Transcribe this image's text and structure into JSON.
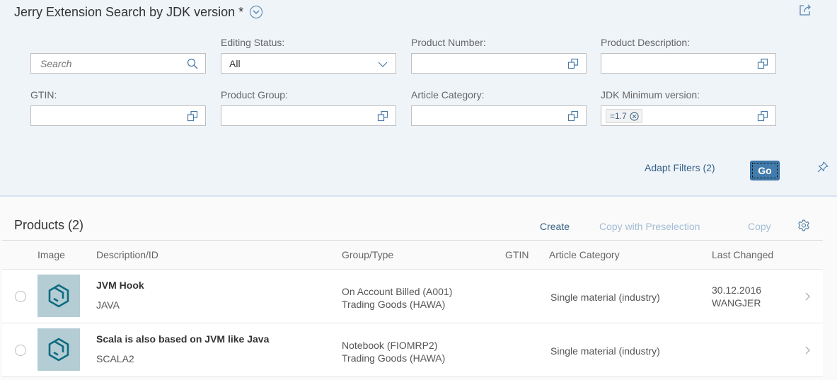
{
  "header": {
    "title": "Jerry Extension Search by JDK version *",
    "variant_icon": "chevron-down-circle-icon",
    "share_icon": "share-icon"
  },
  "filters": {
    "search": {
      "placeholder": "Search",
      "value": "",
      "icon": "search-icon"
    },
    "editing_status": {
      "label": "Editing Status:",
      "value": "All",
      "icon": "chevron-down-icon"
    },
    "product_number": {
      "label": "Product Number:",
      "value": "",
      "icon": "value-help-icon"
    },
    "product_description": {
      "label": "Product Description:",
      "value": "",
      "icon": "value-help-icon"
    },
    "gtin": {
      "label": "GTIN:",
      "value": "",
      "icon": "value-help-icon"
    },
    "product_group": {
      "label": "Product Group:",
      "value": "",
      "icon": "value-help-icon"
    },
    "article_category": {
      "label": "Article Category:",
      "value": "",
      "icon": "value-help-icon"
    },
    "jdk_min_version": {
      "label": "JDK Minimum version:",
      "token": "=1.7",
      "icon": "value-help-icon"
    }
  },
  "actions": {
    "adapt_filters": "Adapt Filters (2)",
    "go": "Go",
    "pin_icon": "pin-icon"
  },
  "products": {
    "title": "Products (2)",
    "toolbar": {
      "create": "Create",
      "copy_with_preselection": "Copy with Preselection",
      "copy": "Copy",
      "settings_icon": "gear-icon"
    },
    "columns": [
      "Image",
      "Description/ID",
      "Group/Type",
      "GTIN",
      "Article Category",
      "Last Changed"
    ],
    "rows": [
      {
        "title": "JVM Hook",
        "id": "JAVA",
        "group": "On Account Billed (A001)",
        "type": "Trading Goods (HAWA)",
        "gtin": "",
        "article_category": "Single material (industry)",
        "last_changed_date": "30.12.2016",
        "last_changed_by": "WANGJER"
      },
      {
        "title": "Scala is also based on JVM like Java",
        "id": "SCALA2",
        "group": "Notebook (FIOMRP2)",
        "type": "Trading Goods (HAWA)",
        "gtin": "",
        "article_category": "Single material (industry)",
        "last_changed_date": "",
        "last_changed_by": ""
      }
    ]
  }
}
